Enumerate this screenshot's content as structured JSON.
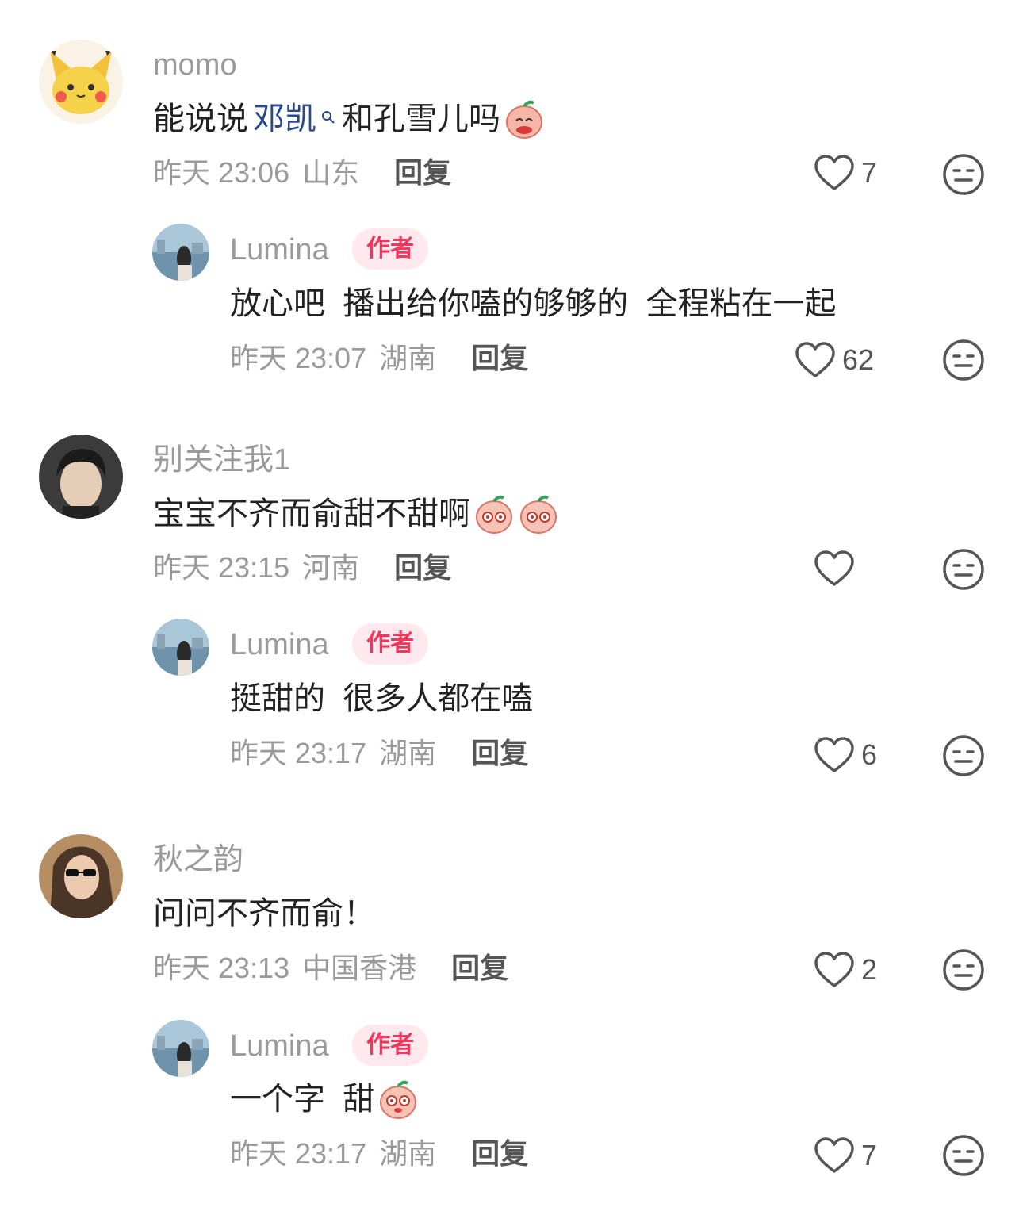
{
  "comments": [
    {
      "user": "momo",
      "text_before": "能说说",
      "mention": "邓凯",
      "text_after": "和孔雪儿吗",
      "time": "昨天 23:06",
      "location": "山东",
      "reply_label": "回复",
      "likes": "7",
      "emoji_count": 1,
      "reply": {
        "user": "Lumina",
        "badge": "作者",
        "text": "放心吧  播出给你嗑的够够的  全程粘在一起",
        "time": "昨天 23:07",
        "location": "湖南",
        "reply_label": "回复",
        "likes": "62"
      }
    },
    {
      "user": "别关注我1",
      "text": "宝宝不齐而俞甜不甜啊",
      "time": "昨天 23:15",
      "location": "河南",
      "reply_label": "回复",
      "likes": "",
      "emoji_count": 2,
      "reply": {
        "user": "Lumina",
        "badge": "作者",
        "text": "挺甜的  很多人都在嗑",
        "time": "昨天 23:17",
        "location": "湖南",
        "reply_label": "回复",
        "likes": "6"
      }
    },
    {
      "user": "秋之韵",
      "text": "问问不齐而俞！",
      "time": "昨天 23:13",
      "location": "中国香港",
      "reply_label": "回复",
      "likes": "2",
      "reply": {
        "user": "Lumina",
        "badge": "作者",
        "text": "一个字  甜",
        "time": "昨天 23:17",
        "location": "湖南",
        "reply_label": "回复",
        "likes": "7",
        "emoji_count": 1
      }
    }
  ],
  "icons": {
    "like": "heart-outline-icon",
    "dislike": "meh-face-icon",
    "mention": "search-icon",
    "emoji": "peach-sticker-icon"
  },
  "colors": {
    "username": "#9a9a9a",
    "badge_bg": "#ffe9ee",
    "badge_text": "#f5365c",
    "mention": "#2b4a8a"
  }
}
